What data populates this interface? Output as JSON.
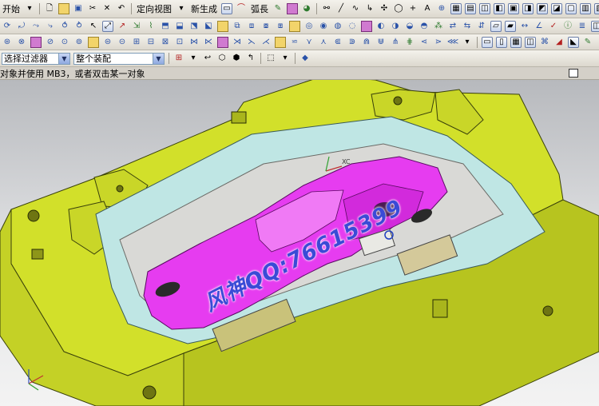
{
  "toolbar_top": {
    "start_label": "开始",
    "orient_view_label": "定向视图",
    "new_label": "新生成",
    "arc_label": "弧長"
  },
  "selection_bar": {
    "filter_value": "选择过滤器",
    "assembly_value": "整个装配"
  },
  "cue_line": {
    "message": "对象并使用 MB3，或者双击某一对象"
  },
  "viewport": {
    "watermark": "风神QQ:76615399",
    "wcs_label": "XC",
    "colors": {
      "mold_base": "#d2e02a",
      "cavity_wall": "#bfe6e4",
      "part": "#e63cf0",
      "background_top": "#b7b9bd",
      "background_bottom": "#f3f3f3"
    }
  }
}
